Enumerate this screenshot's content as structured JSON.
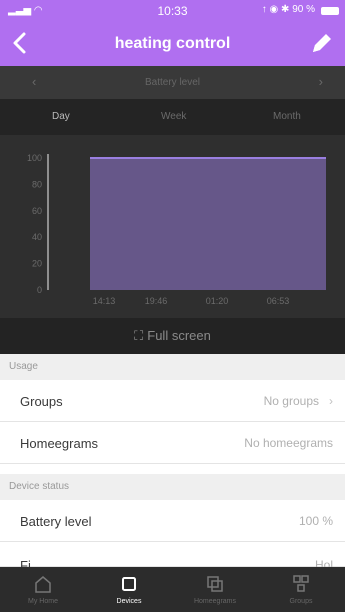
{
  "status_bar": {
    "time": "10:33",
    "right": "↑ ◉ ✱ 90 %"
  },
  "nav": {
    "title": "heating control"
  },
  "metric": {
    "label": "Battery level"
  },
  "tabs": [
    {
      "label": "Day",
      "active": true
    },
    {
      "label": "Week",
      "active": false
    },
    {
      "label": "Month",
      "active": false
    }
  ],
  "chart_data": {
    "type": "area",
    "x": [
      "14:13",
      "19:46",
      "01:20",
      "06:53"
    ],
    "series": [
      {
        "values": [
          100,
          100,
          100,
          100
        ],
        "color": "#7a66a8"
      }
    ],
    "yticks": [
      0,
      20,
      40,
      60,
      80,
      100
    ],
    "ylim": [
      0,
      100
    ],
    "grid": false
  },
  "fullscreen_label": "Full screen",
  "sections": {
    "usage": "Usage",
    "device_status": "Device status"
  },
  "rows": {
    "groups": {
      "name": "Groups",
      "value": "No groups"
    },
    "homeegrams": {
      "name": "Homeegrams",
      "value": "No homeegrams"
    },
    "battery": {
      "name": "Battery level",
      "value": "100 %"
    },
    "partial": {
      "name": "Fi",
      "value": "Hol"
    }
  },
  "tab_bar": [
    {
      "label": "My Home",
      "icon": "home-icon",
      "active": false
    },
    {
      "label": "Devices",
      "icon": "devices-icon",
      "active": true
    },
    {
      "label": "Homeegrams",
      "icon": "homeegrams-icon",
      "active": false
    },
    {
      "label": "Groups",
      "icon": "groups-icon",
      "active": false
    }
  ],
  "colors": {
    "accent": "#b06ff0",
    "chart_fill": "#7a66a8",
    "chart_line": "#9a7fe0",
    "dark_bg": "#2f2f2f"
  }
}
